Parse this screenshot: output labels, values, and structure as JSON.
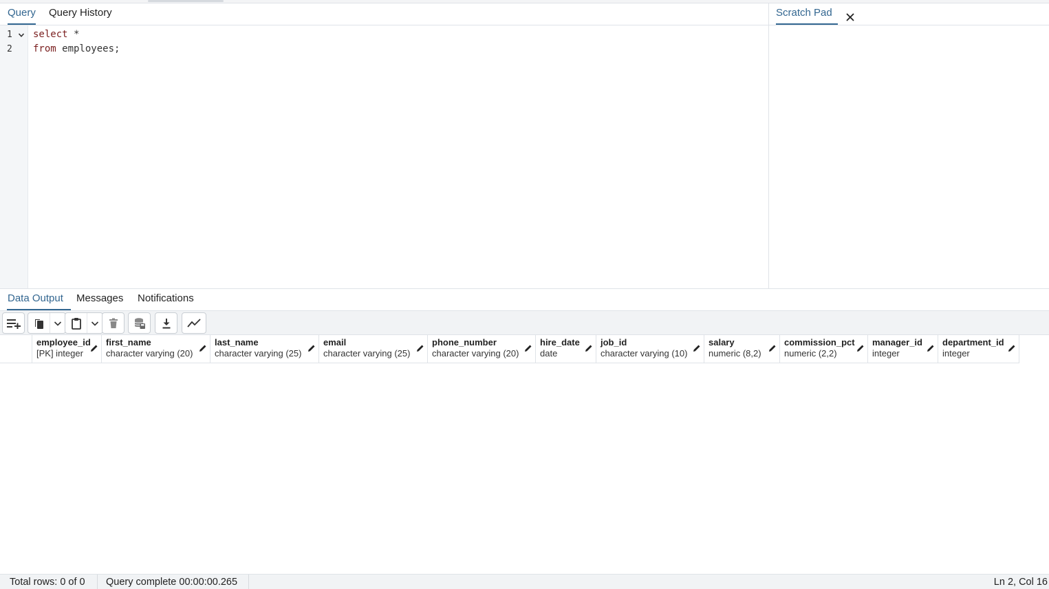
{
  "query_tabs": [
    {
      "label": "Query",
      "active": true
    },
    {
      "label": "Query History",
      "active": false
    }
  ],
  "scratch_pad": {
    "label": "Scratch Pad"
  },
  "editor": {
    "line_numbers": [
      "1",
      "2"
    ],
    "lines": [
      {
        "keyword": "select",
        "rest": " *"
      },
      {
        "keyword": "from",
        "rest": " employees;"
      }
    ]
  },
  "output_tabs": [
    {
      "label": "Data Output",
      "active": true
    },
    {
      "label": "Messages",
      "active": false
    },
    {
      "label": "Notifications",
      "active": false
    }
  ],
  "toolbar_icons": [
    "add-row-icon",
    "copy-icon",
    "chevron-down-icon",
    "paste-icon",
    "chevron-down-icon",
    "delete-icon",
    "save-data-icon",
    "download-icon",
    "graph-visualiser-icon"
  ],
  "columns": [
    {
      "name": "employee_id",
      "type": "[PK] integer"
    },
    {
      "name": "first_name",
      "type": "character varying (20)"
    },
    {
      "name": "last_name",
      "type": "character varying (25)"
    },
    {
      "name": "email",
      "type": "character varying (25)"
    },
    {
      "name": "phone_number",
      "type": "character varying (20)"
    },
    {
      "name": "hire_date",
      "type": "date"
    },
    {
      "name": "job_id",
      "type": "character varying (10)"
    },
    {
      "name": "salary",
      "type": "numeric (8,2)"
    },
    {
      "name": "commission_pct",
      "type": "numeric (2,2)"
    },
    {
      "name": "manager_id",
      "type": "integer"
    },
    {
      "name": "department_id",
      "type": "integer"
    }
  ],
  "status": {
    "total_rows": "Total rows: 0 of 0",
    "query_complete": "Query complete 00:00:00.265",
    "cursor": "Ln 2, Col 16"
  },
  "colors": {
    "accent": "#326690",
    "keyword": "#7a1f1f"
  }
}
